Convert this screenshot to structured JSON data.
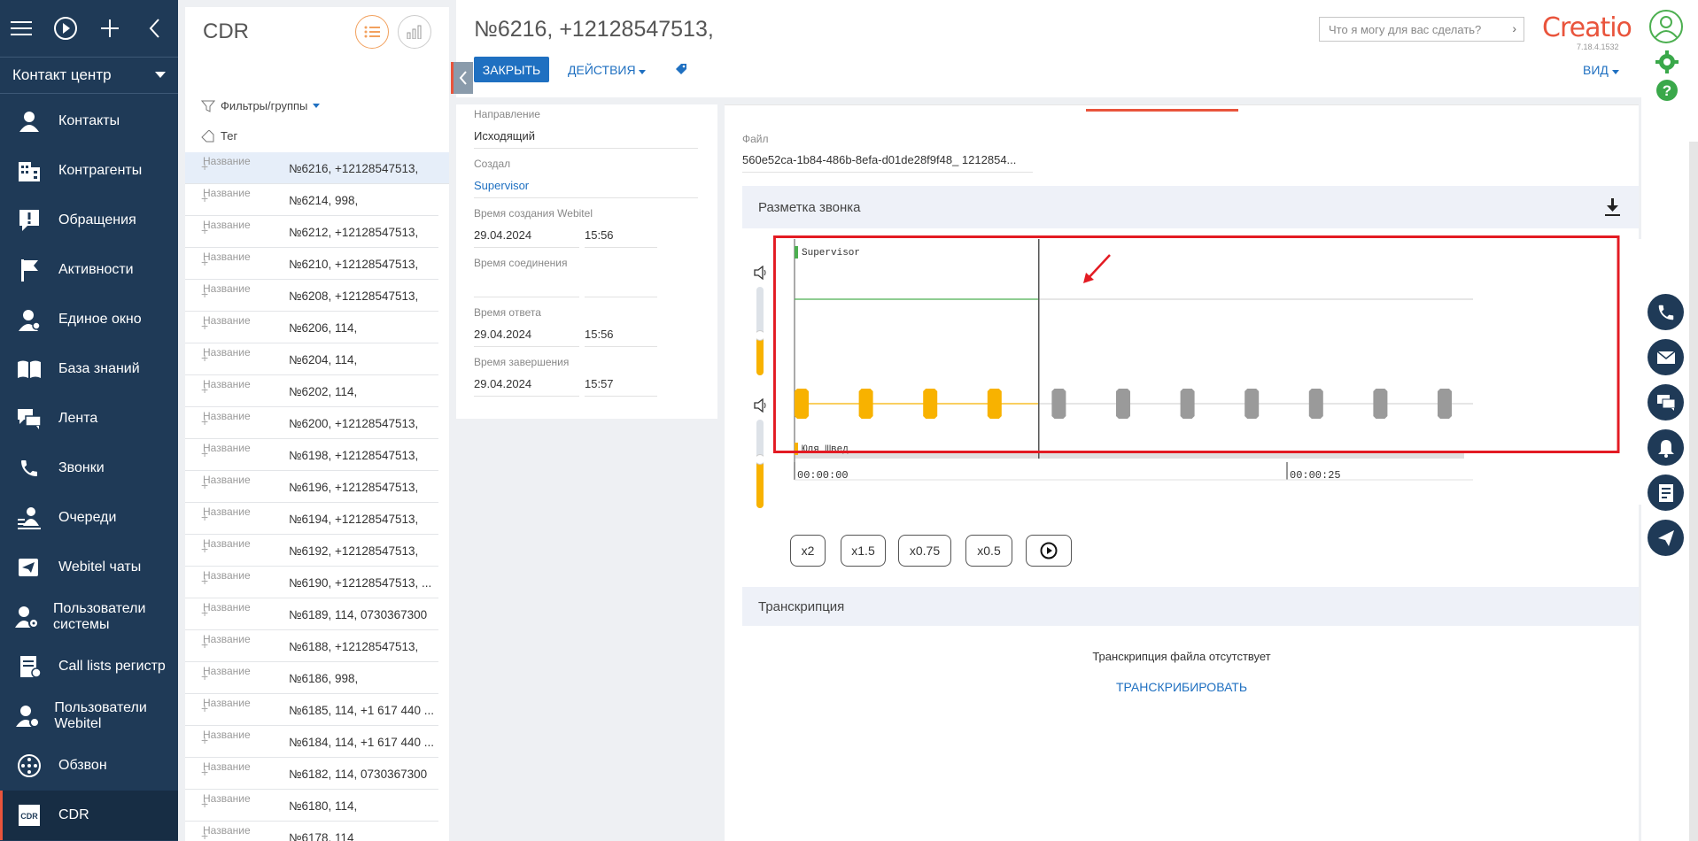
{
  "nav": {
    "workspace": "Контакт центр",
    "items": [
      {
        "label": "Контакты",
        "icon": "person-icon"
      },
      {
        "label": "Контрагенты",
        "icon": "building-icon"
      },
      {
        "label": "Обращения",
        "icon": "alert-icon"
      },
      {
        "label": "Активности",
        "icon": "flag-icon"
      },
      {
        "label": "Единое окно",
        "icon": "agent-icon"
      },
      {
        "label": "База знаний",
        "icon": "book-icon"
      },
      {
        "label": "Лента",
        "icon": "chat-icon"
      },
      {
        "label": "Звонки",
        "icon": "phone-icon"
      },
      {
        "label": "Очереди",
        "icon": "queue-icon"
      },
      {
        "label": "Webitel чаты",
        "icon": "send-icon"
      },
      {
        "label": "Пользователи системы",
        "icon": "user-gear-icon"
      },
      {
        "label": "Call lists регистр",
        "icon": "calllist-icon"
      },
      {
        "label": "Пользователи Webitel",
        "icon": "users-icon"
      },
      {
        "label": "Обзвон",
        "icon": "dial-icon"
      },
      {
        "label": "CDR",
        "icon": "cdr-icon"
      }
    ]
  },
  "list": {
    "title": "CDR",
    "filters_label": "Фильтры/группы",
    "tag_label": "Тег",
    "column_label": "Название",
    "rows": [
      "№6216, +12128547513,",
      "№6214, 998,",
      "№6212, +12128547513,",
      "№6210, +12128547513,",
      "№6208, +12128547513,",
      "№6206, 114,",
      "№6204, 114,",
      "№6202, 114,",
      "№6200, +12128547513,",
      "№6198, +12128547513,",
      "№6196, +12128547513,",
      "№6194, +12128547513,",
      "№6192, +12128547513,",
      "№6190, +12128547513, ...",
      "№6189, 114, 0730367300",
      "№6188, +12128547513,",
      "№6186, 998,",
      "№6185, 114, +1 617 440 ...",
      "№6184, 114, +1 617 440 ...",
      "№6182, 114, 0730367300",
      "№6180, 114,",
      "№6178, 114"
    ]
  },
  "header": {
    "title": "№6216, +12128547513,",
    "close_label": "ЗАКРЫТЬ",
    "actions_label": "ДЕЙСТВИЯ",
    "search_placeholder": "Что я могу для вас сделать?",
    "logo": "Creatio",
    "version": "7.18.4.1532",
    "view_label": "ВИД"
  },
  "details": {
    "direction_label": "Направление",
    "direction_value": "Исходящий",
    "created_by_label": "Создал",
    "created_by_value": "Supervisor",
    "webitel_created_label": "Время создания Webitel",
    "webitel_created_date": "29.04.2024",
    "webitel_created_time": "15:56",
    "connect_label": "Время соединения",
    "answer_label": "Время ответа",
    "answer_date": "29.04.2024",
    "answer_time": "15:56",
    "end_label": "Время завершения",
    "end_date": "29.04.2024",
    "end_time": "15:57"
  },
  "recording": {
    "file_label": "Файл",
    "file_value": "560e52ca-1b84-486b-8efa-d01de28f9f48_ 1212854...",
    "section_title": "Разметка звонка",
    "speaker_top": "Supervisor",
    "speaker_bottom": "Юля Швед",
    "time_start": "00:00:00",
    "time_mark": "00:00:25",
    "speeds": [
      "x2",
      "x1.5",
      "x0.75",
      "x0.5"
    ],
    "top_volume": 0.45,
    "bottom_volume": 0.55,
    "playhead_fraction": 0.36
  },
  "transcription": {
    "title": "Транскрипция",
    "empty_text": "Транскрипция файла отсутствует",
    "action_label": "ТРАНСКРИБИРОВАТЬ"
  },
  "colors": {
    "nav_bg": "#1f3a57",
    "accent": "#e9543c",
    "link": "#1f70c1",
    "wave_orange": "#f8b200",
    "wave_grey": "#9a9a9a",
    "highlight": "#e31b23"
  }
}
